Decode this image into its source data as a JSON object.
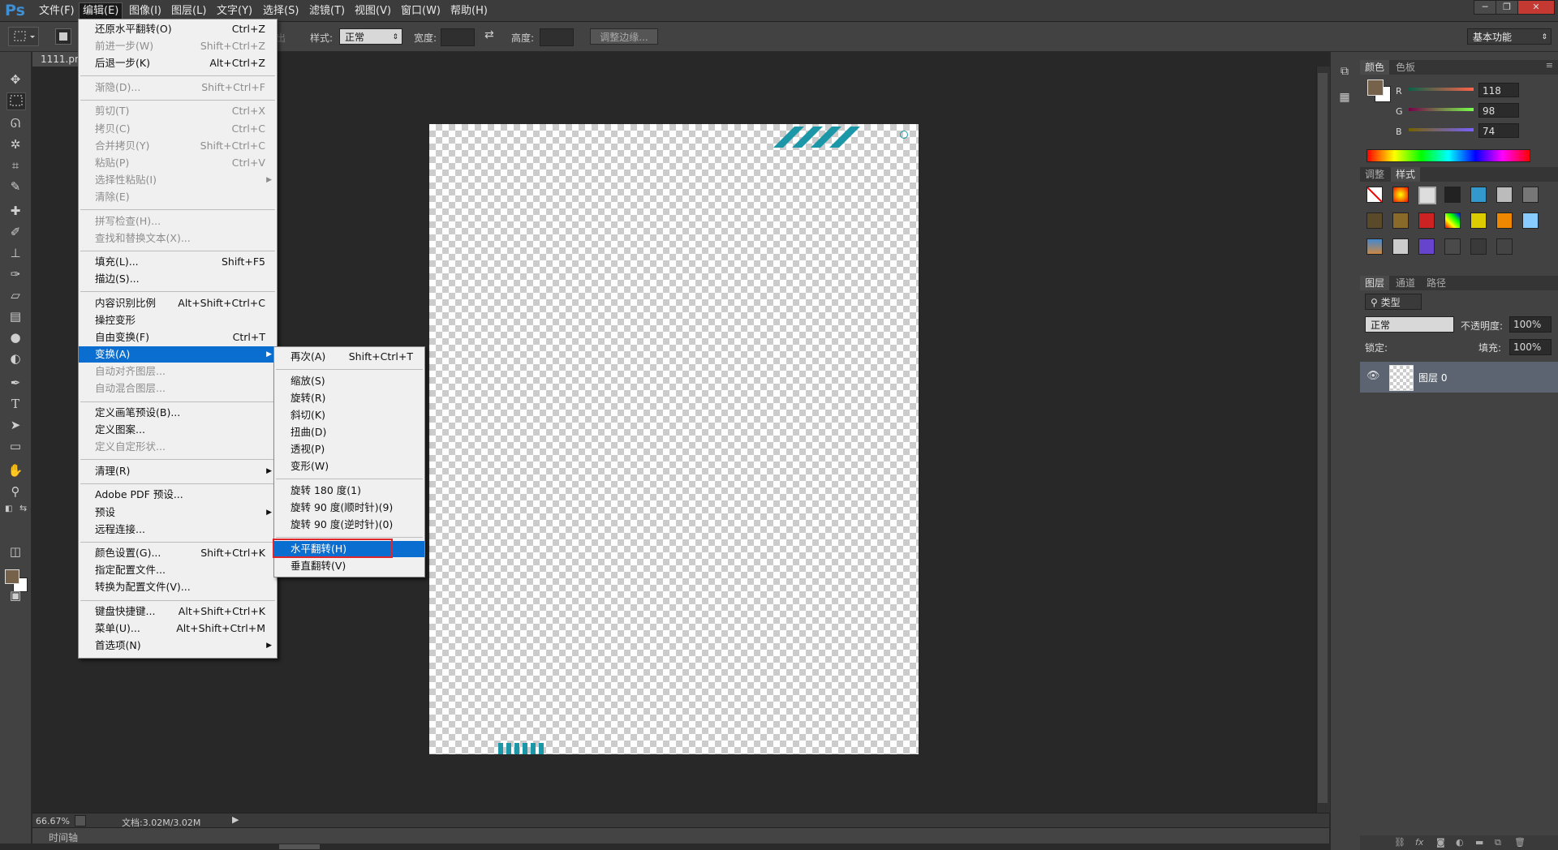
{
  "app": {
    "logo": "Ps"
  },
  "menubar": {
    "items": [
      "文件(F)",
      "编辑(E)",
      "图像(I)",
      "图层(L)",
      "文字(Y)",
      "选择(S)",
      "滤镜(T)",
      "视图(V)",
      "窗口(W)",
      "帮助(H)"
    ],
    "active": "编辑(E)"
  },
  "window_buttons": {
    "minimize": "─",
    "restore": "❐",
    "close": "✕"
  },
  "options_bar": {
    "feather_label": "出",
    "style_label": "样式:",
    "style_value": "正常",
    "width_label": "宽度:",
    "height_label": "高度:",
    "refine_edge": "调整边缘...",
    "workspace": "基本功能"
  },
  "document": {
    "tab": "1111.pn",
    "zoom": "66.67%",
    "doc_size": "文档:3.02M/3.02M",
    "timeline": "时间轴"
  },
  "edit_menu": [
    {
      "label": "还原水平翻转(O)",
      "shortcut": "Ctrl+Z",
      "enabled": true
    },
    {
      "label": "前进一步(W)",
      "shortcut": "Shift+Ctrl+Z",
      "enabled": false
    },
    {
      "label": "后退一步(K)",
      "shortcut": "Alt+Ctrl+Z",
      "enabled": true
    },
    {
      "sep": true
    },
    {
      "label": "渐隐(D)...",
      "shortcut": "Shift+Ctrl+F",
      "enabled": false
    },
    {
      "sep": true
    },
    {
      "label": "剪切(T)",
      "shortcut": "Ctrl+X",
      "enabled": false
    },
    {
      "label": "拷贝(C)",
      "shortcut": "Ctrl+C",
      "enabled": false
    },
    {
      "label": "合并拷贝(Y)",
      "shortcut": "Shift+Ctrl+C",
      "enabled": false
    },
    {
      "label": "粘贴(P)",
      "shortcut": "Ctrl+V",
      "enabled": false
    },
    {
      "label": "选择性粘贴(I)",
      "shortcut": "",
      "enabled": false,
      "submenu": true
    },
    {
      "label": "清除(E)",
      "shortcut": "",
      "enabled": false
    },
    {
      "sep": true
    },
    {
      "label": "拼写检查(H)...",
      "shortcut": "",
      "enabled": false
    },
    {
      "label": "查找和替换文本(X)...",
      "shortcut": "",
      "enabled": false
    },
    {
      "sep": true
    },
    {
      "label": "填充(L)...",
      "shortcut": "Shift+F5",
      "enabled": true
    },
    {
      "label": "描边(S)...",
      "shortcut": "",
      "enabled": true
    },
    {
      "sep": true
    },
    {
      "label": "内容识别比例",
      "shortcut": "Alt+Shift+Ctrl+C",
      "enabled": true
    },
    {
      "label": "操控变形",
      "shortcut": "",
      "enabled": true
    },
    {
      "label": "自由变换(F)",
      "shortcut": "Ctrl+T",
      "enabled": true
    },
    {
      "label": "变换(A)",
      "shortcut": "",
      "enabled": true,
      "submenu": true,
      "highlighted": true
    },
    {
      "label": "自动对齐图层...",
      "shortcut": "",
      "enabled": false
    },
    {
      "label": "自动混合图层...",
      "shortcut": "",
      "enabled": false
    },
    {
      "sep": true
    },
    {
      "label": "定义画笔预设(B)...",
      "shortcut": "",
      "enabled": true
    },
    {
      "label": "定义图案...",
      "shortcut": "",
      "enabled": true
    },
    {
      "label": "定义自定形状...",
      "shortcut": "",
      "enabled": false
    },
    {
      "sep": true
    },
    {
      "label": "清理(R)",
      "shortcut": "",
      "enabled": true,
      "submenu": true
    },
    {
      "sep": true
    },
    {
      "label": "Adobe PDF 预设...",
      "shortcut": "",
      "enabled": true
    },
    {
      "label": "预设",
      "shortcut": "",
      "enabled": true,
      "submenu": true
    },
    {
      "label": "远程连接...",
      "shortcut": "",
      "enabled": true
    },
    {
      "sep": true
    },
    {
      "label": "颜色设置(G)...",
      "shortcut": "Shift+Ctrl+K",
      "enabled": true
    },
    {
      "label": "指定配置文件...",
      "shortcut": "",
      "enabled": true
    },
    {
      "label": "转换为配置文件(V)...",
      "shortcut": "",
      "enabled": true
    },
    {
      "sep": true
    },
    {
      "label": "键盘快捷键...",
      "shortcut": "Alt+Shift+Ctrl+K",
      "enabled": true
    },
    {
      "label": "菜单(U)...",
      "shortcut": "Alt+Shift+Ctrl+M",
      "enabled": true
    },
    {
      "label": "首选项(N)",
      "shortcut": "",
      "enabled": true,
      "submenu": true
    }
  ],
  "transform_menu": [
    {
      "label": "再次(A)",
      "shortcut": "Shift+Ctrl+T"
    },
    {
      "sep": true
    },
    {
      "label": "缩放(S)",
      "shortcut": ""
    },
    {
      "label": "旋转(R)",
      "shortcut": ""
    },
    {
      "label": "斜切(K)",
      "shortcut": ""
    },
    {
      "label": "扭曲(D)",
      "shortcut": ""
    },
    {
      "label": "透视(P)",
      "shortcut": ""
    },
    {
      "label": "变形(W)",
      "shortcut": ""
    },
    {
      "sep": true
    },
    {
      "label": "旋转 180 度(1)",
      "shortcut": ""
    },
    {
      "label": "旋转 90 度(顺时针)(9)",
      "shortcut": ""
    },
    {
      "label": "旋转 90 度(逆时针)(0)",
      "shortcut": ""
    },
    {
      "sep": true
    },
    {
      "label": "水平翻转(H)",
      "shortcut": "",
      "highlighted": true,
      "boxed": true
    },
    {
      "label": "垂直翻转(V)",
      "shortcut": ""
    }
  ],
  "color_panel": {
    "tabs": [
      "颜色",
      "色板"
    ],
    "r_label": "R",
    "g_label": "G",
    "b_label": "B",
    "r": "118",
    "g": "98",
    "b": "74",
    "foreground": "#76624a"
  },
  "styles_panel": {
    "tabs": [
      "调整",
      "样式"
    ]
  },
  "layers_panel": {
    "tabs": [
      "图层",
      "通道",
      "路径"
    ],
    "kind_filter": "类型",
    "blend_mode": "正常",
    "opacity_label": "不透明度:",
    "opacity": "100%",
    "lock_label": "锁定:",
    "fill_label": "填充:",
    "fill": "100%",
    "layer_name": "图层 0"
  },
  "colors": {
    "accent": "#0a6ed1",
    "highlight_box": "#e0252b",
    "stripe": "#1b97a8"
  }
}
